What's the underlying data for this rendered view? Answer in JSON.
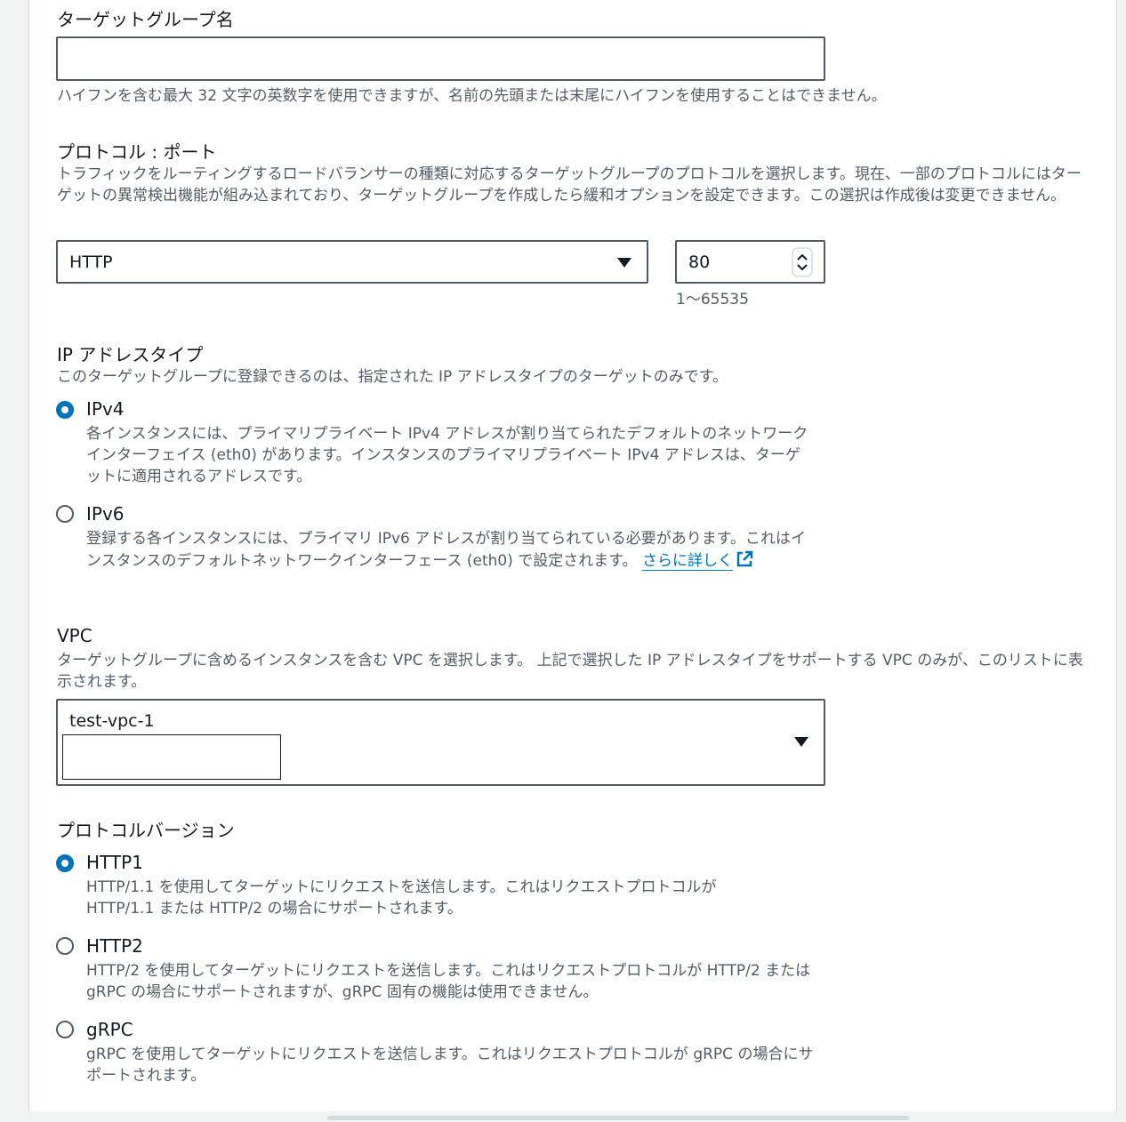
{
  "target_group_name": {
    "label": "ターゲットグループ名",
    "value": "",
    "hint": "ハイフンを含む最大 32 文字の英数字を使用できますが、名前の先頭または末尾にハイフンを使用することはできません。"
  },
  "protocol_port": {
    "label": "プロトコル : ポート",
    "description": "トラフィックをルーティングするロードバランサーの種類に対応するターゲットグループのプロトコルを選択します。現在、一部のプロトコルにはターゲットの異常検出機能が組み込まれており、ターゲットグループを作成したら緩和オプションを設定できます。この選択は作成後は変更できません。",
    "protocol_value": "HTTP",
    "port_value": "80",
    "port_hint": "1〜65535"
  },
  "ip_address_type": {
    "label": "IP アドレスタイプ",
    "description": "このターゲットグループに登録できるのは、指定された IP アドレスタイプのターゲットのみです。",
    "options": [
      {
        "label": "IPv4",
        "checked": true,
        "description": "各インスタンスには、プライマリプライベート IPv4 アドレスが割り当てられたデフォルトのネットワークインターフェイス (eth0) があります。インスタンスのプライマリプライベート IPv4 アドレスは、ターゲットに適用されるアドレスです。"
      },
      {
        "label": "IPv6",
        "checked": false,
        "description": "登録する各インスタンスには、プライマリ IPv6 アドレスが割り当てられている必要があります。これはインスタンスのデフォルトネットワークインターフェース (eth0) で設定されます。",
        "link": "さらに詳しく"
      }
    ]
  },
  "vpc": {
    "label": "VPC",
    "description": "ターゲットグループに含めるインスタンスを含む VPC を選択します。 上記で選択した IP アドレスタイプをサポートする VPC のみが、このリストに表示されます。",
    "value": "test-vpc-1"
  },
  "protocol_version": {
    "label": "プロトコルバージョン",
    "options": [
      {
        "label": "HTTP1",
        "checked": true,
        "description": "HTTP/1.1 を使用してターゲットにリクエストを送信します。これはリクエストプロトコルが HTTP/1.1 または HTTP/2 の場合にサポートされます。"
      },
      {
        "label": "HTTP2",
        "checked": false,
        "description": "HTTP/2 を使用してターゲットにリクエストを送信します。これはリクエストプロトコルが HTTP/2 または gRPC の場合にサポートされますが、gRPC 固有の機能は使用できません。"
      },
      {
        "label": "gRPC",
        "checked": false,
        "description": "gRPC を使用してターゲットにリクエストを送信します。これはリクエストプロトコルが gRPC の場合にサポートされます。"
      }
    ]
  },
  "colors": {
    "accent": "#0073bb",
    "text": "#16191f",
    "secondary_text": "#545b64"
  },
  "icons": [
    "chevron-down-icon",
    "stepper-icon",
    "external-link-icon"
  ]
}
